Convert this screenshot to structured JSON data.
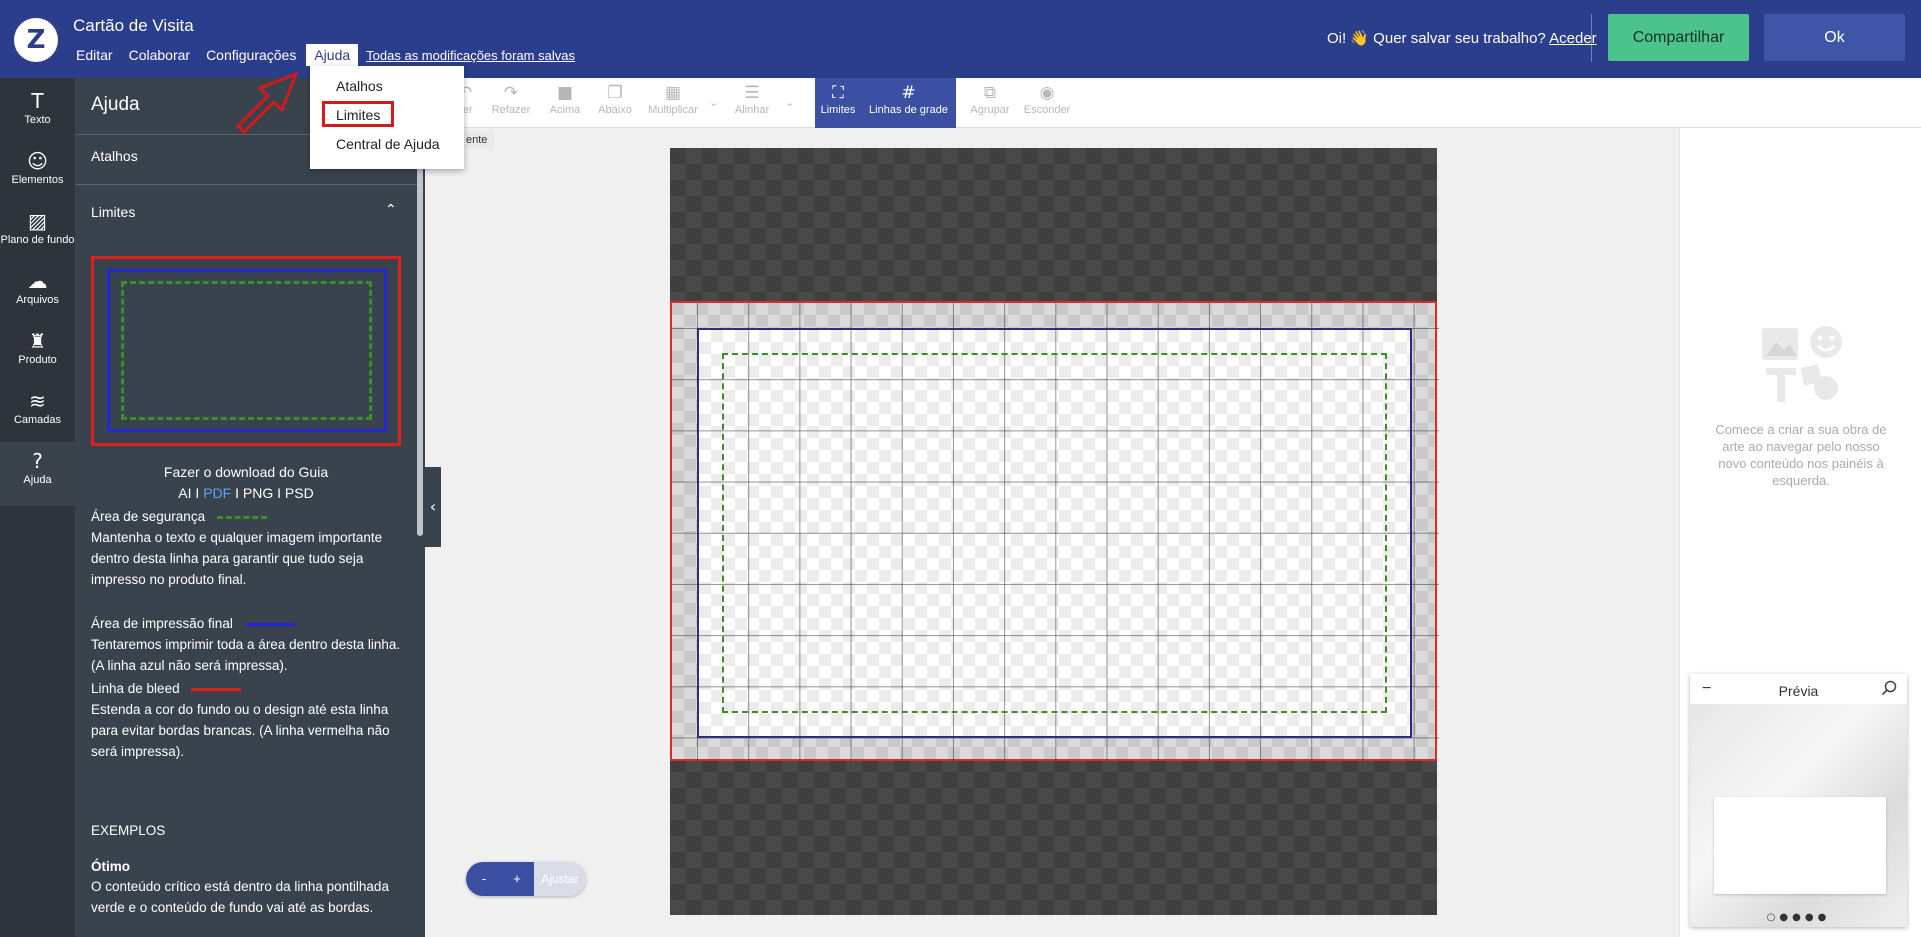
{
  "app": {
    "logo_icon": "zazzle-logo",
    "title": "Cartão de Visita"
  },
  "menubar": {
    "items": [
      "Editar",
      "Colaborar",
      "Configurações",
      "Ajuda"
    ],
    "active": "Ajuda",
    "save_status": "Todas as modificações foram salvas"
  },
  "header": {
    "greeting": "Oi! 👋 Quer salvar seu trabalho?",
    "login_link": "Aceder",
    "share_label": "Compartilhar",
    "ok_label": "Ok"
  },
  "rail": {
    "items": [
      {
        "label": "Texto",
        "icon": "text-icon"
      },
      {
        "label": "Elementos",
        "icon": "elements-icon"
      },
      {
        "label": "Plano de fundo",
        "icon": "background-icon"
      },
      {
        "label": "Arquivos",
        "icon": "upload-icon"
      },
      {
        "label": "Produto",
        "icon": "product-icon"
      },
      {
        "label": "Camadas",
        "icon": "layers-icon"
      },
      {
        "label": "Ajuda",
        "icon": "help-icon",
        "active": true
      }
    ]
  },
  "help_panel": {
    "title": "Ajuda",
    "section_shortcuts": "Atalhos",
    "section_limits": "Limites",
    "download_label": "Fazer o download do Guia",
    "formats": {
      "ai": "AI",
      "pdf": "PDF",
      "png": "PNG",
      "psd": "PSD"
    },
    "safety_title": "Área de segurança",
    "safety_text": "Mantenha o texto e qualquer imagem importante dentro desta linha para garantir que tudo seja impresso no produto final.",
    "print_title": "Área de impressão final",
    "print_text": "Tentaremos imprimir toda a área dentro desta linha. (A linha azul não será impressa).",
    "bleed_title": "Linha de bleed",
    "bleed_text": "Estenda a cor do fundo ou o design até esta linha para evitar bordas brancas. (A linha vermelha não será impressa).",
    "examples_heading": "EXEMPLOS",
    "example_great_title": "Ótimo",
    "example_great_text": "O conteúdo crítico está dentro da linha pontilhada verde e o conteúdo de fundo vai até as bordas.",
    "colors": {
      "safety": "#3f8c2a",
      "print": "#2626d6",
      "bleed": "#e02020"
    }
  },
  "dropdown": {
    "items": [
      "Atalhos",
      "Limites",
      "Central de Ajuda"
    ],
    "highlighted": "Limites"
  },
  "tooltip_fragment": "ente",
  "toolbar": {
    "items": [
      {
        "label": "zer",
        "icon": "undo-icon",
        "enabled": false
      },
      {
        "label": "Refazer",
        "icon": "redo-icon",
        "enabled": false
      },
      {
        "label": "Acima",
        "icon": "bring-forward-icon",
        "enabled": false
      },
      {
        "label": "Abaixo",
        "icon": "send-backward-icon",
        "enabled": false
      },
      {
        "label": "Multiplicar",
        "icon": "multiply-icon",
        "enabled": false
      },
      {
        "label": "Alinhar",
        "icon": "align-icon",
        "enabled": false
      },
      {
        "label": "Limites",
        "icon": "limits-icon",
        "enabled": true,
        "active": true
      },
      {
        "label": "Linhas de grade",
        "icon": "grid-icon",
        "enabled": true,
        "active": true
      },
      {
        "label": "Agrupar",
        "icon": "group-icon",
        "enabled": false
      },
      {
        "label": "Esconder",
        "icon": "hide-icon",
        "enabled": false
      }
    ]
  },
  "zoom": {
    "minus": "-",
    "plus": "+",
    "fit_label": "Ajustar"
  },
  "right_panel": {
    "empty_text": "Comece a criar a sua obra de arte ao navegar pelo nosso novo conteúdo nos painéis à esquerda."
  },
  "preview": {
    "title": "Prévia",
    "collapse": "−",
    "page_count": 5,
    "current_page": 1
  },
  "colors": {
    "header_bg": "#2a3e8c",
    "share_btn": "#4cc38a",
    "ok_btn": "#3f56a8",
    "panel_bg": "#39434d",
    "annotation_red": "#d11a1a"
  }
}
